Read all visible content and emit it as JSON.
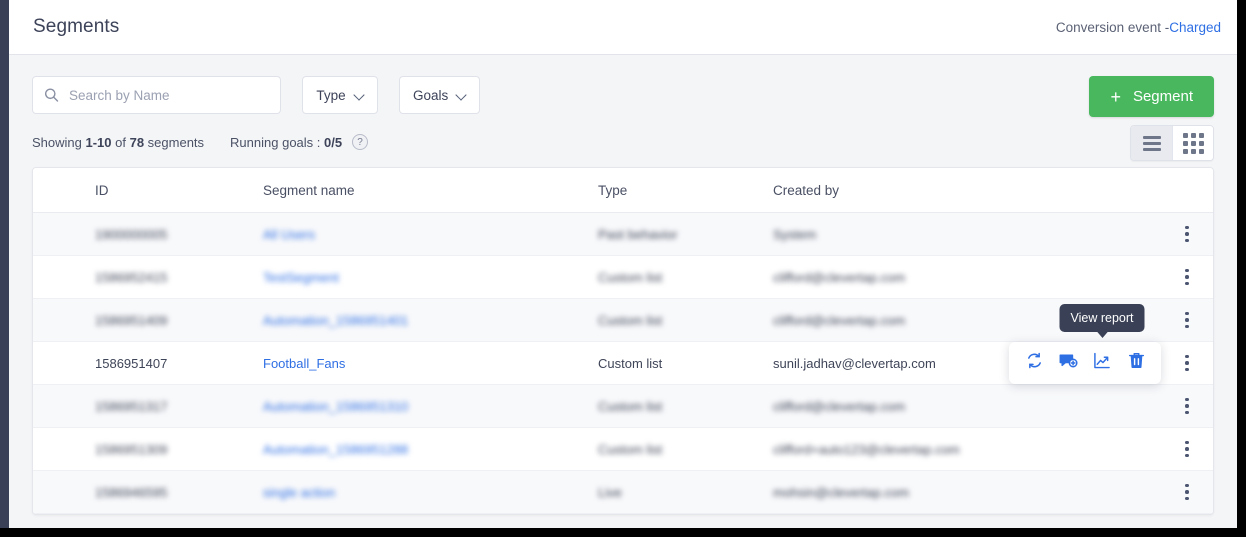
{
  "header": {
    "title": "Segments",
    "conversion_label": "Conversion event -",
    "conversion_event": "Charged"
  },
  "filters": {
    "search_placeholder": "Search by Name",
    "search_value": "",
    "type_label": "Type",
    "goals_label": "Goals",
    "create_button": "Segment",
    "create_button_icon": "plus-icon",
    "create_button_color": "#49b75d"
  },
  "meta": {
    "showing_prefix": "Showing ",
    "showing_range": "1-10",
    "showing_of": " of ",
    "showing_total": "78",
    "showing_suffix": " segments",
    "running_goals_label": "Running goals : ",
    "running_goals_value": "0/5",
    "help_icon": "?"
  },
  "view_toggle": {
    "list_label": "list-view",
    "grid_label": "grid-view",
    "active": "list"
  },
  "table": {
    "columns": [
      "ID",
      "Segment name",
      "Type",
      "Created by"
    ],
    "rows": [
      {
        "id": "1900000005",
        "name": "All Users",
        "type": "Past behavior",
        "created_by": "System",
        "blurred": true
      },
      {
        "id": "1586952415",
        "name": "TestSegment",
        "type": "Custom list",
        "created_by": "clifford@clevertap.com",
        "blurred": true
      },
      {
        "id": "1586951409",
        "name": "Automation_1586951401",
        "type": "Custom list",
        "created_by": "clifford@clevertap.com",
        "blurred": true
      },
      {
        "id": "1586951407",
        "name": "Football_Fans",
        "type": "Custom list",
        "created_by": "sunil.jadhav@clevertap.com",
        "blurred": false
      },
      {
        "id": "1586951317",
        "name": "Automation_1586951310",
        "type": "Custom list",
        "created_by": "clifford@clevertap.com",
        "blurred": true
      },
      {
        "id": "1586951309",
        "name": "Automation_1586951288",
        "type": "Custom list",
        "created_by": "clifford+auto123@clevertap.com",
        "blurred": true
      },
      {
        "id": "1586946595",
        "name": "single action",
        "type": "Live",
        "created_by": "mohsin@clevertap.com",
        "blurred": true
      }
    ],
    "row_menu_icon": "kebab-menu-icon"
  },
  "row_actions": {
    "on_row_index": 3,
    "tooltip": "View report",
    "items": [
      {
        "icon": "refresh-icon",
        "name": "refresh-segment-action"
      },
      {
        "icon": "campaign-icon",
        "name": "create-campaign-action"
      },
      {
        "icon": "chart-icon",
        "name": "view-report-action"
      },
      {
        "icon": "trash-icon",
        "name": "delete-segment-action"
      }
    ],
    "icon_color": "#2f6fe4"
  }
}
